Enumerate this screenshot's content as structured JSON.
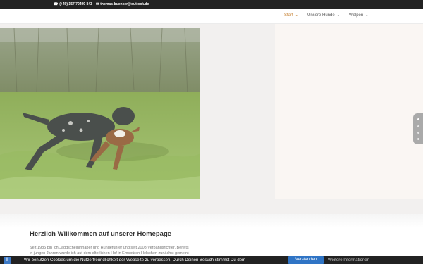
{
  "topbar": {
    "phone": "(+49) 157 70499 843",
    "email": "thomas-buenker@outlook.de"
  },
  "nav": {
    "items": [
      {
        "label": "Start",
        "active": true
      },
      {
        "label": "Unsere Hunde",
        "active": false
      },
      {
        "label": "Welpen",
        "active": false
      }
    ]
  },
  "slider": {
    "slide_count": 4,
    "active_index": 0
  },
  "welcome": {
    "title": "Herzlich Willkommen auf unserer Homepage",
    "text_line1": "Seit 1985 bin ich Jagdscheininhaber und Hundeführer und seit 2008 Verbandsrichter. Bereits",
    "text_line2": "in jungen Jahren wurde ich auf dem elterlichen Hof in Emsbüren-Helschen zunächst gemeint"
  },
  "cookie": {
    "message": "Wir benutzen Cookies um die Nutzerfreundlichkeit der Webseite zu verbessen. Durch Deinen Besuch stimmst Du dem",
    "accept_label": "Verstanden",
    "more_label": "Weitere Informationen"
  },
  "colors": {
    "accent": "#c47d2c",
    "topbar": "#222222",
    "cookie_button": "#2f74c5"
  }
}
